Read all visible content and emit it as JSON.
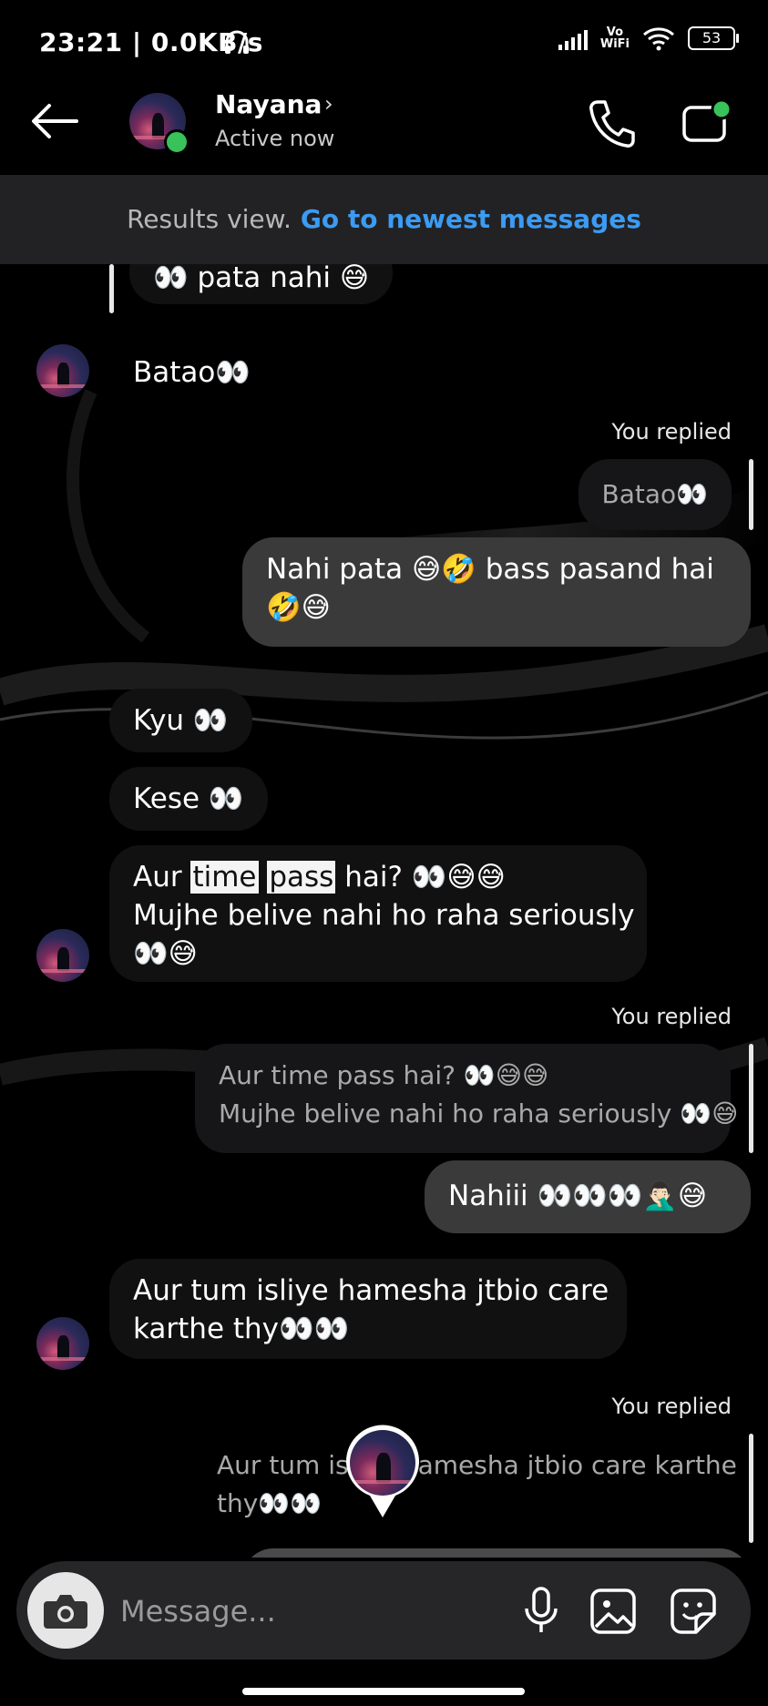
{
  "status_bar": {
    "time": "23:21 | 0.0KB/s",
    "vowifi_top": "Vo",
    "vowifi_bottom": "WiFi",
    "battery": "53"
  },
  "header": {
    "name": "Nayana",
    "status": "Active now"
  },
  "results_bar": {
    "label": "Results view.",
    "link": "Go to newest messages"
  },
  "messages": {
    "m1": "👀 pata nahi 😅",
    "m2": "Batao👀",
    "reply1_label": "You replied",
    "reply1_quote": "Batao👀",
    "m3_line1": "Nahi pata 😅🤣 bass pasand hai",
    "m3_line2": "🤣😅",
    "m4": "Kyu 👀",
    "m5": "Kese 👀",
    "m6_pre": "Aur ",
    "m6_hl1": "time",
    "m6_hl2": "pass",
    "m6_post": " hai? 👀😅😅",
    "m6_line2": "Mujhe belive nahi ho raha seriously",
    "m6_line3": "👀😅",
    "reply2_label": "You replied",
    "reply2_quote_line1": "Aur time pass hai? 👀😅😅",
    "reply2_quote_line2": "Mujhe belive nahi ho raha seriously 👀😅",
    "m7": "Nahiii 👀👀👀🤦🏻‍♂️😅",
    "m8_line1": "Aur tum isliye hamesha jtbio care",
    "m8_line2": "karthe thy👀👀",
    "reply3_label": "You replied",
    "reply3_quote_line1": "Aur tum isliye hamesha jtbio care karthe",
    "reply3_quote_line2": "thy👀👀"
  },
  "composer": {
    "placeholder": "Message..."
  },
  "colors": {
    "link": "#3c9bf2",
    "online": "#39c15a",
    "outgoing_bubble": "#3a3a3a",
    "results_bar": "#222224"
  }
}
